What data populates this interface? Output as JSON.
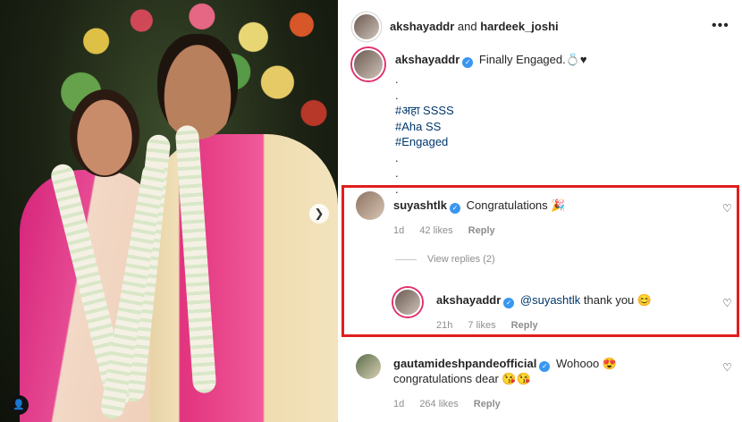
{
  "photo": {
    "carousel_next_glyph": "❯",
    "tag_glyph": "👤"
  },
  "header": {
    "user1": "akshayaddr",
    "joiner": "and",
    "user2": "hardeek_joshi",
    "more_glyph": "•••"
  },
  "caption": {
    "username": "akshayaddr",
    "verified_glyph": "✓",
    "text": "Finally Engaged.💍♥",
    "lines": [
      ".",
      ".",
      "#अहा SSSS",
      "#Aha SS",
      "#Engaged",
      ".",
      ".",
      "."
    ]
  },
  "comments": [
    {
      "username": "suyashtlk",
      "text": "Congratulations 🎉",
      "time": "1d",
      "likes": "42 likes",
      "reply": "Reply",
      "view_replies": "View replies (2)"
    },
    {
      "username": "akshayaddr",
      "mention": "@suyashtlk",
      "text": "thank you 😊",
      "time": "21h",
      "likes": "7 likes",
      "reply": "Reply"
    },
    {
      "username": "gautamideshpandeofficial",
      "text": "Wohooo 😍 congratulations dear 😘😘",
      "time": "1d",
      "likes": "264 likes",
      "reply": "Reply"
    }
  ],
  "heart_glyph": "♡",
  "colors": {
    "highlight_border": "#e01e1e",
    "verified": "#3897f0",
    "link": "#00376b"
  }
}
